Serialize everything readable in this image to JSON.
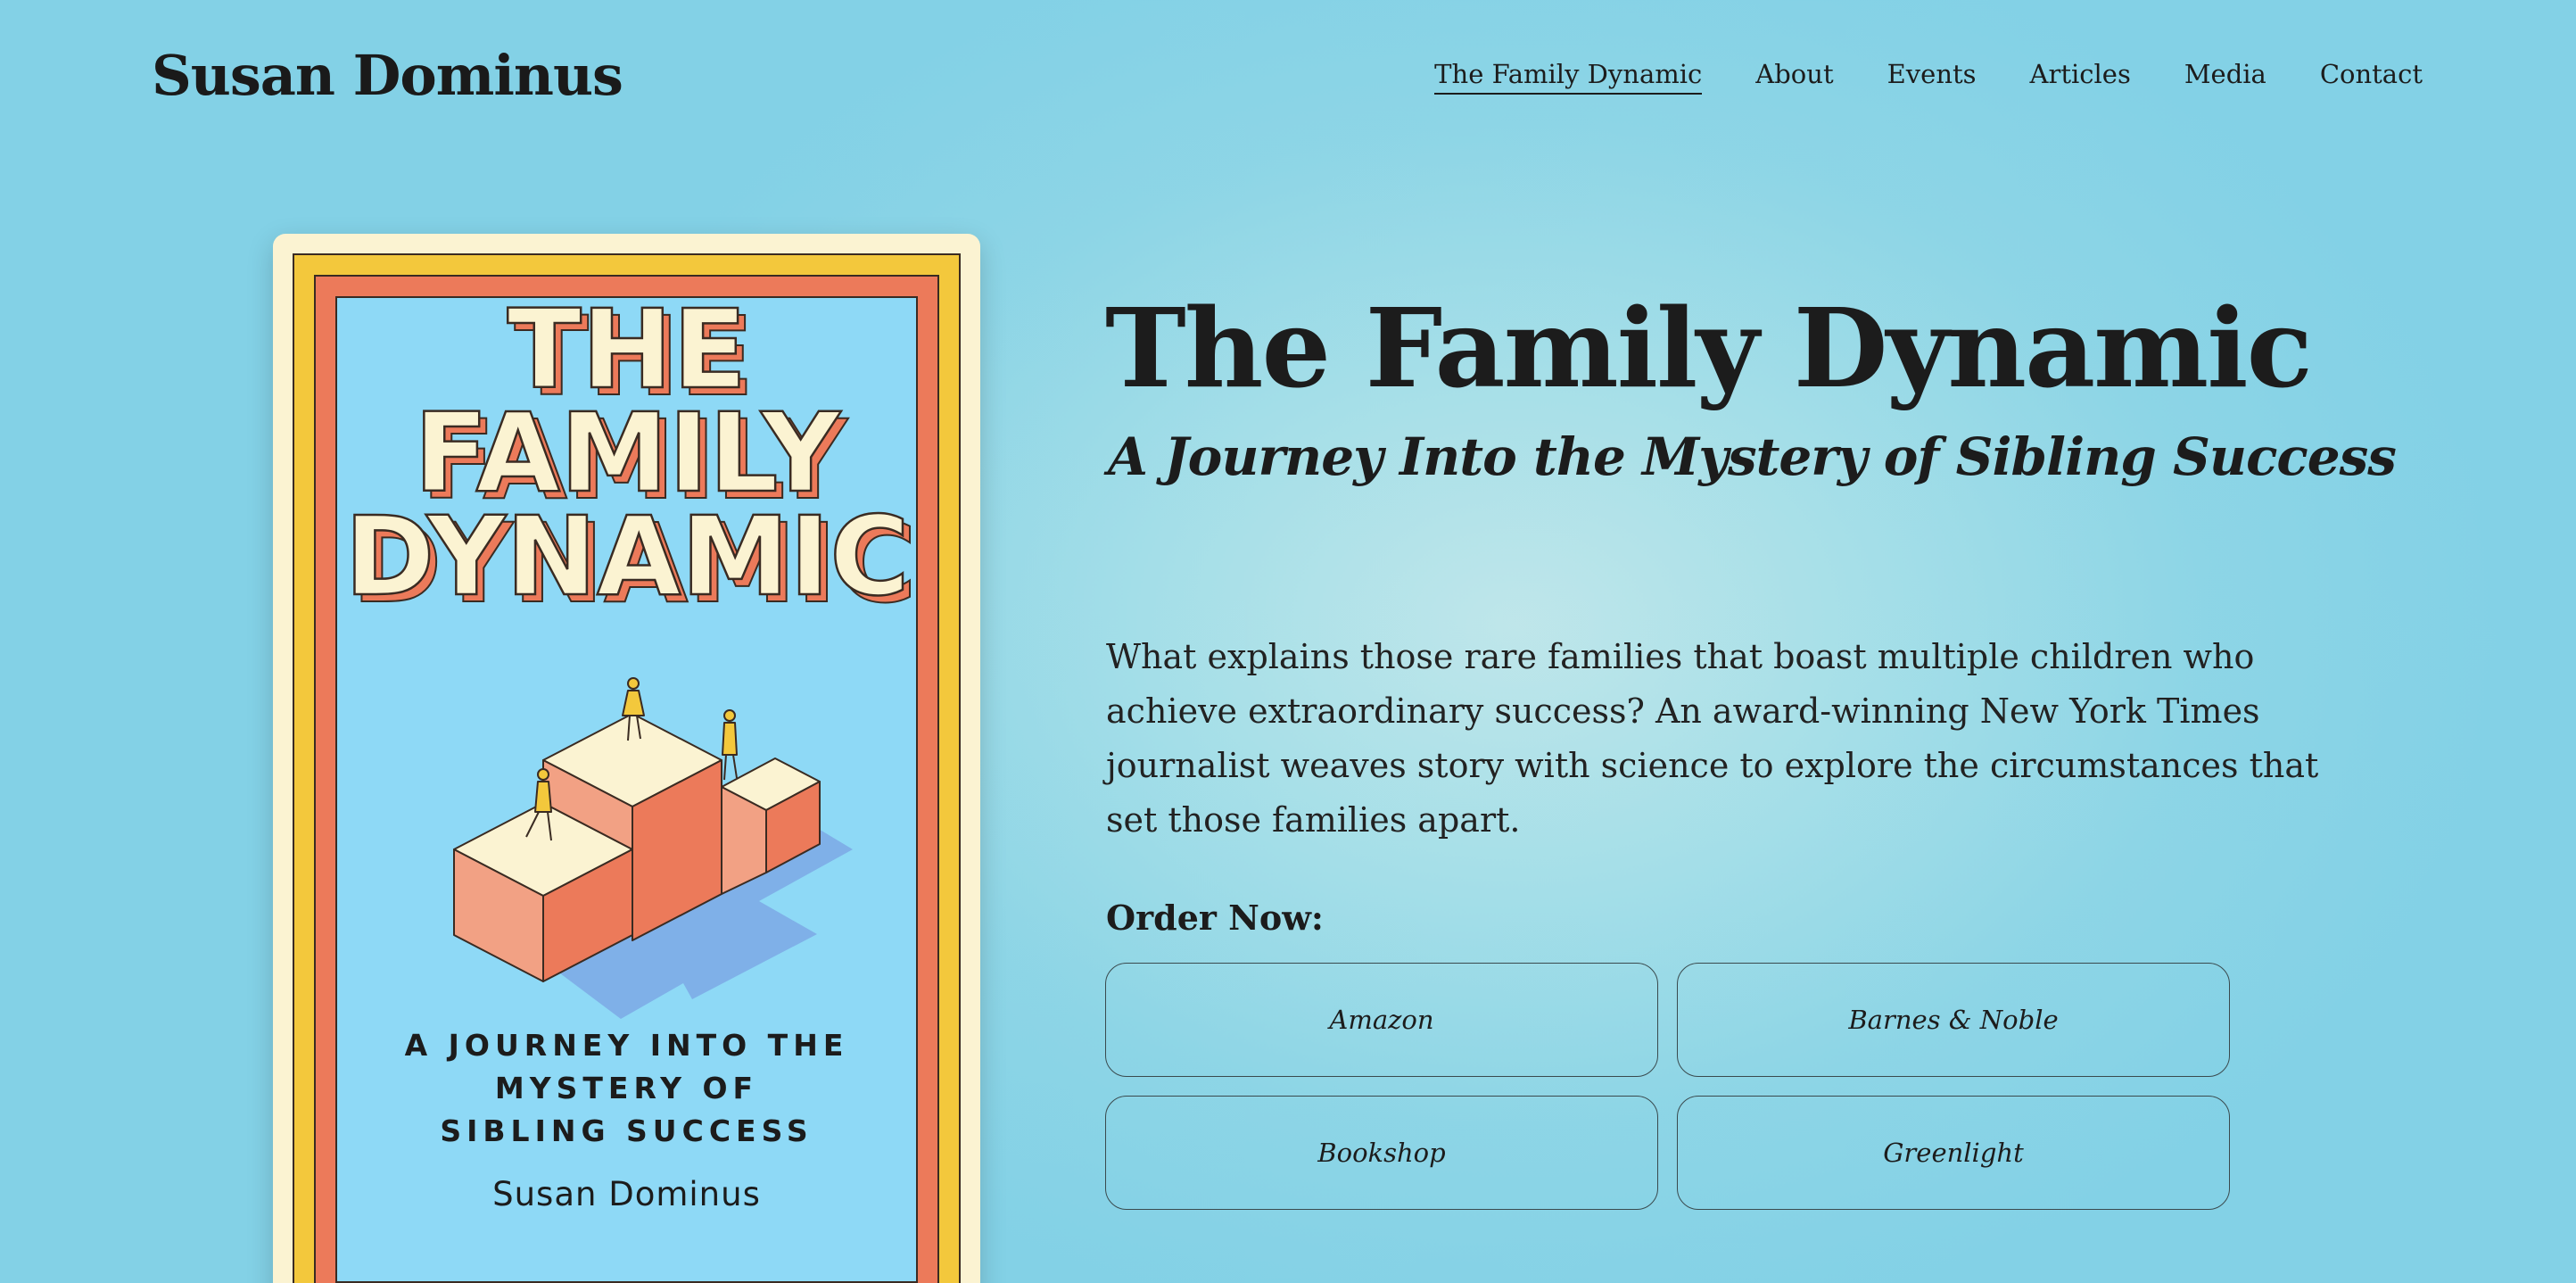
{
  "header": {
    "site_title": "Susan Dominus",
    "nav": [
      {
        "label": "The Family Dynamic",
        "active": true
      },
      {
        "label": "About"
      },
      {
        "label": "Events"
      },
      {
        "label": "Articles"
      },
      {
        "label": "Media"
      },
      {
        "label": "Contact"
      }
    ]
  },
  "book_cover": {
    "title_lines": [
      "THE",
      "FAMILY",
      "DYNAMIC"
    ],
    "subtitle_lines": [
      "A JOURNEY INTO THE",
      "MYSTERY OF",
      "SIBLING SUCCESS"
    ],
    "author": "Susan Dominus",
    "colors": {
      "frame": "#fbf3d2",
      "yellow": "#f3c83c",
      "coral": "#ec7a5a",
      "sky": "#8ed9f6",
      "shadow": "#7fb0e8"
    }
  },
  "main": {
    "title": "The Family Dynamic",
    "subtitle": "A Journey Into the Mystery of Sibling Success",
    "description": "What explains those rare families that boast multiple children who achieve extraordinary success? An award-winning New York Times journalist weaves story with science to explore the circumstances that set those families apart.",
    "order_label": "Order Now:",
    "retailers": [
      "Amazon",
      "Barnes & Noble",
      "Bookshop",
      "Greenlight"
    ]
  }
}
